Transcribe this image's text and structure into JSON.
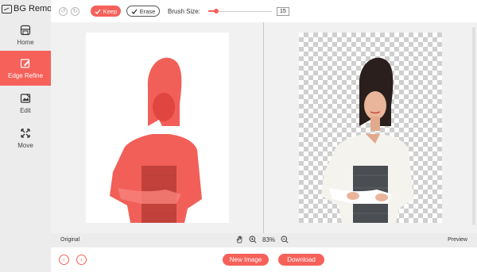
{
  "app": {
    "title": "BG Remover"
  },
  "sidebar": {
    "items": [
      {
        "label": "Home",
        "icon": "home-icon"
      },
      {
        "label": "Edge Refine",
        "icon": "edge-refine-icon",
        "active": true
      },
      {
        "label": "Edit",
        "icon": "edit-image-icon"
      },
      {
        "label": "Move",
        "icon": "move-icon"
      }
    ]
  },
  "toolbar": {
    "keep_label": "Keep",
    "erase_label": "Erase",
    "brush_size_label": "Brush Size:",
    "brush_size_value": "15",
    "brush_size_fraction": 0.12
  },
  "statusbar": {
    "original_label": "Original",
    "preview_label": "Preview",
    "zoom_value": "83%"
  },
  "bottombar": {
    "new_image_label": "New Image",
    "download_label": "Download"
  },
  "colors": {
    "accent": "#f6615a",
    "red_overlay": "#f0524a",
    "checker": "#cfcfcf"
  }
}
